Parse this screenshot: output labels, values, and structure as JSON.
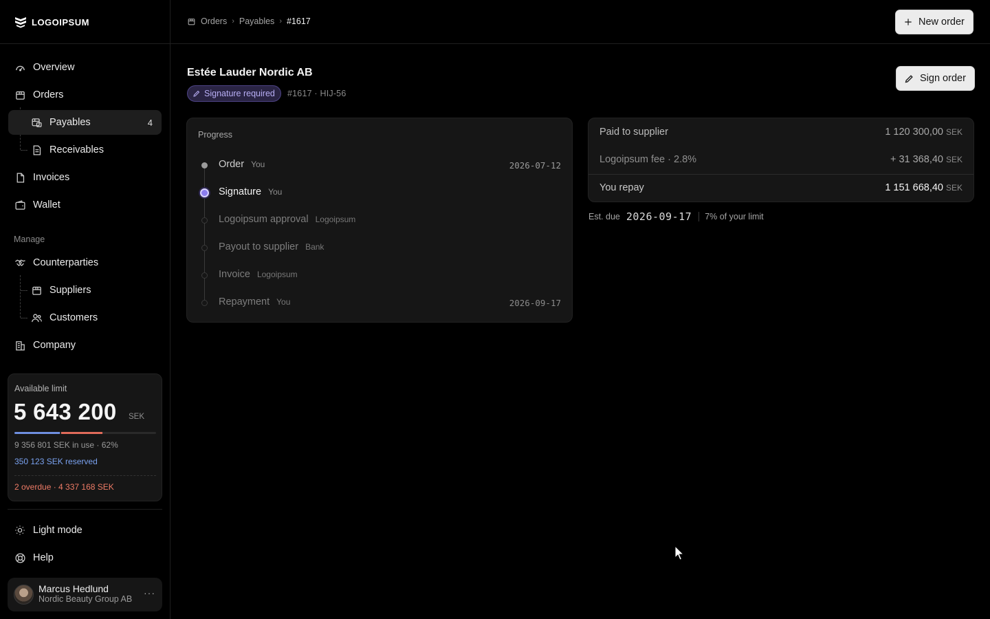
{
  "app": {
    "logo_text": "LOGOIPSUM"
  },
  "sidebar": {
    "nav": {
      "overview": "Overview",
      "orders": "Orders",
      "payables": "Payables",
      "payables_count": "4",
      "receivables": "Receivables",
      "invoices": "Invoices",
      "wallet": "Wallet"
    },
    "manage_label": "Manage",
    "manage": {
      "counterparties": "Counterparties",
      "suppliers": "Suppliers",
      "customers": "Customers",
      "company": "Company"
    },
    "limit": {
      "label": "Available limit",
      "amount": "5 643 200",
      "currency": "SEK",
      "in_use_fraction": 0.32,
      "reserved_fraction": 0.29,
      "in_use_text": "9 356 801 SEK in use · 62%",
      "reserved_text": "350 123 SEK reserved",
      "overdue_text": "2 overdue · 4 337 168 SEK"
    },
    "light_mode": "Light mode",
    "help": "Help",
    "user": {
      "name": "Marcus Hedlund",
      "org": "Nordic Beauty Group AB",
      "more": "···"
    }
  },
  "breadcrumb": {
    "orders": "Orders",
    "payables": "Payables",
    "current": "#1617"
  },
  "header": {
    "new_order": "New order",
    "sign_order": "Sign order"
  },
  "order": {
    "title": "Estée Lauder Nordic AB",
    "badge": "Signature required",
    "reference": "#1617 · HIJ-56"
  },
  "progress": {
    "header": "Progress",
    "steps": [
      {
        "name": "Order",
        "who": "You",
        "date": "2026-07-12"
      },
      {
        "name": "Signature",
        "who": "You",
        "date": ""
      },
      {
        "name": "Logoipsum approval",
        "who": "Logoipsum",
        "date": ""
      },
      {
        "name": "Payout to supplier",
        "who": "Bank",
        "date": ""
      },
      {
        "name": "Invoice",
        "who": "Logoipsum",
        "date": ""
      },
      {
        "name": "Repayment",
        "who": "You",
        "date": "2026-09-17"
      }
    ]
  },
  "summary": {
    "paid_label": "Paid to supplier",
    "paid_value": "1 120 300,00",
    "fee_label": "Logoipsum fee · 2.8%",
    "fee_value": "+ 31 368,40",
    "repay_label": "You repay",
    "repay_value": "1 151 668,40",
    "currency": "SEK"
  },
  "due": {
    "label": "Est. due",
    "date": "2026-09-17",
    "limit_share": "7% of your limit"
  },
  "colors": {
    "accent": "#8b7cf0",
    "reserved": "#7aa2f0",
    "overdue": "#ee7b66"
  }
}
